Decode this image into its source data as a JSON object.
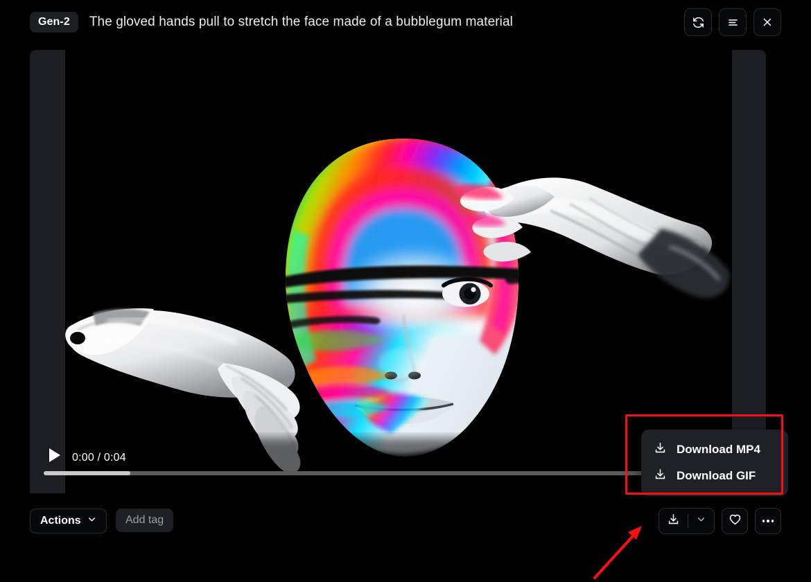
{
  "header": {
    "badge": "Gen-2",
    "title": "The gloved hands pull to stretch the face made of a bubblegum material",
    "buttons": [
      {
        "name": "refresh-icon",
        "label": "Regenerate"
      },
      {
        "name": "list-icon",
        "label": "Details"
      },
      {
        "name": "close-icon",
        "label": "Close"
      }
    ]
  },
  "player": {
    "current_time": "0:00",
    "duration": "0:04",
    "timecode": "0:00 / 0:04",
    "progress_percent": 12,
    "play_label": "Play",
    "video_description": "A glossy white mannequin-like face with an iridescent rainbow gradient across the forehead and cheek, being stretched by two white gloved hands on a black background"
  },
  "bottom_bar": {
    "actions_label": "Actions",
    "add_tag_label": "Add tag",
    "download_label": "Download",
    "download_caret_label": "Download options",
    "favorite_label": "Favorite",
    "more_label": "More options"
  },
  "dropdown": {
    "items": [
      {
        "label": "Download MP4",
        "icon": "download-icon"
      },
      {
        "label": "Download GIF",
        "icon": "download-icon"
      }
    ]
  },
  "annotations": {
    "highlight_color": "#fa0f0f",
    "rect_target": "download-dropdown-menu",
    "arrow_target": "download-split-button"
  },
  "colors": {
    "page_background": "#000000",
    "panel_background": "#1c1e23",
    "menu_background": "#1f2126",
    "text_primary": "#ffffff",
    "text_muted": "#9aa0a8",
    "annotation_red": "#fa0f0f"
  }
}
